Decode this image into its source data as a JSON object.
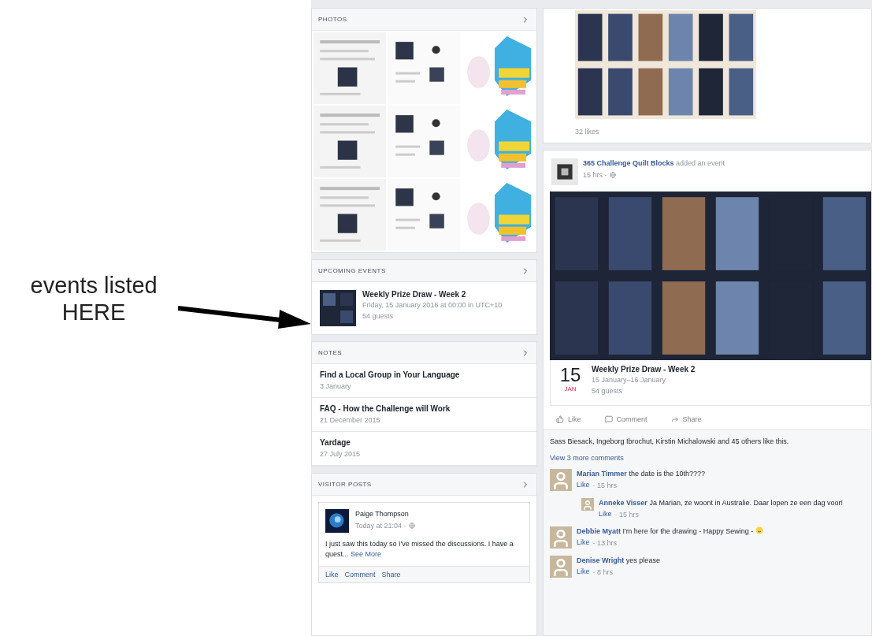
{
  "annotation": {
    "text": "events listed\nHERE"
  },
  "sidebar": {
    "photos": {
      "title": "PHOTOS"
    },
    "upcoming_events": {
      "title": "UPCOMING EVENTS",
      "items": [
        {
          "title": "Weekly Prize Draw - Week 2",
          "when": "Friday, 15 January 2016 at 00:00 in UTC+10",
          "guests": "54 guests"
        }
      ]
    },
    "notes": {
      "title": "NOTES",
      "items": [
        {
          "title": "Find a Local Group in Your Language",
          "date": "3 January"
        },
        {
          "title": "FAQ - How the Challenge will Work",
          "date": "21 December 2015"
        },
        {
          "title": "Yardage",
          "date": "27 July 2015"
        }
      ]
    },
    "visitor_posts": {
      "title": "VISITOR POSTS",
      "post": {
        "author": "Paige Thompson",
        "time": "Today at 21:04 ·",
        "text": "I just saw this today so I've missed the discussions. I have a quest...",
        "see_more": "See More",
        "actions": [
          "Like",
          "Comment",
          "Share"
        ]
      }
    }
  },
  "feed": {
    "photo_post": {
      "likes": "32 likes"
    },
    "event_post": {
      "page": "365 Challenge Quilt Blocks",
      "action": "added an event",
      "time": "15 hrs ·",
      "event": {
        "day": "15",
        "month": "JAN",
        "title": "Weekly Prize Draw - Week 2",
        "dates": "15 January–16 January",
        "guests": "54 guests"
      },
      "actions": [
        {
          "kind": "like",
          "label": "Like"
        },
        {
          "kind": "comment",
          "label": "Comment"
        },
        {
          "kind": "share",
          "label": "Share"
        }
      ],
      "likes": "Sass Biesack, Ingeborg Ibrochut, Kirstin Michalowski and 45 others like this.",
      "more_comments": "View 3 more comments",
      "comments": [
        {
          "author": "Marian Timmer",
          "text": "the date is the 10th????",
          "like": "Like",
          "time": "· 15 hrs",
          "emoji": false,
          "replies": [
            {
              "author": "Anneke Visser",
              "text": "Ja Marian, ze woont in Australie. Daar lopen ze een dag voor!",
              "like": "Like",
              "time": "· 15 hrs",
              "emoji": false
            }
          ]
        },
        {
          "author": "Debbie Myatt",
          "text": "I'm here for the drawing - Happy Sewing -",
          "like": "Like",
          "time": "· 13 hrs",
          "emoji": true
        },
        {
          "author": "Denise Wright",
          "text": "yes please",
          "like": "Like",
          "time": "· 8 hrs",
          "emoji": false
        }
      ]
    }
  }
}
